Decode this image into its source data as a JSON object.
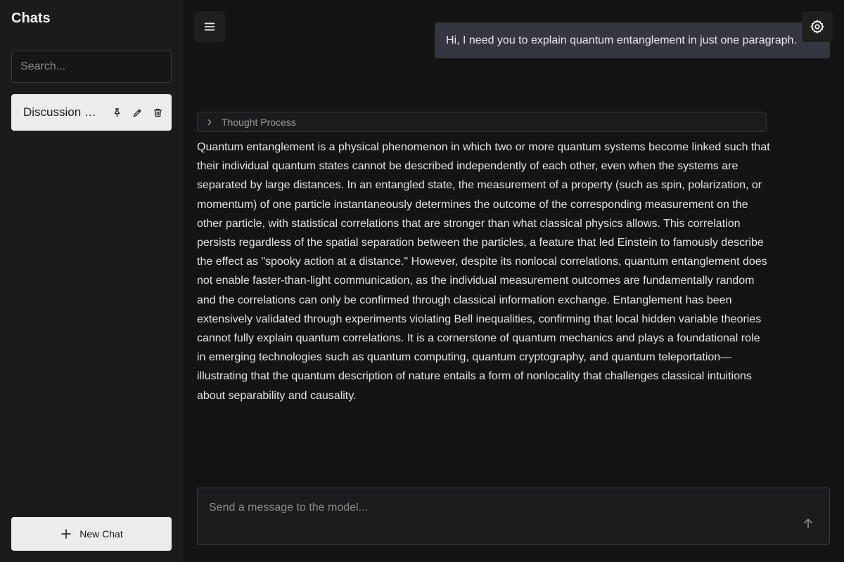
{
  "sidebar": {
    "title": "Chats",
    "search_placeholder": "Search...",
    "items": [
      {
        "label": "Discussion on Quantum Entanglement",
        "pin_icon": "pin-icon",
        "edit_icon": "pencil-icon",
        "delete_icon": "trash-icon"
      }
    ],
    "new_chat_label": "New Chat",
    "new_chat_icon": "plus-icon"
  },
  "header": {
    "menu_icon": "hamburger-menu-icon",
    "settings_icon": "gear-icon"
  },
  "conversation": {
    "user_message": "Hi, I need you to explain quantum entanglement in just one paragraph.",
    "thought_process_label": "Thought Process",
    "assistant_message": "Quantum entanglement is a physical phenomenon in which two or more quantum systems become linked such that their individual quantum states cannot be described independently of each other, even when the systems are separated by large distances. In an entangled state, the measurement of a property (such as spin, polarization, or momentum) of one particle instantaneously determines the outcome of the corresponding measurement on the other particle, with statistical correlations that are stronger than what classical physics allows. This correlation persists regardless of the spatial separation between the particles, a feature that led Einstein to famously describe the effect as \"spooky action at a distance.\" However, despite its nonlocal correlations, quantum entanglement does not enable faster-than-light communication, as the individual measurement outcomes are fundamentally random and the correlations can only be confirmed through classical information exchange. Entanglement has been extensively validated through experiments violating Bell inequalities, confirming that local hidden variable theories cannot fully explain quantum correlations. It is a cornerstone of quantum mechanics and plays a foundational role in emerging technologies such as quantum computing, quantum cryptography, and quantum teleportation—illustrating that the quantum description of nature entails a form of nonlocality that challenges classical intuitions about separability and causality."
  },
  "composer": {
    "placeholder": "Send a message to the model...",
    "send_icon": "arrow-up-icon"
  },
  "colors": {
    "background": "#141414",
    "sidebar": "#1b1b1b",
    "user_bubble": "#363640",
    "light_button": "#ececec"
  }
}
